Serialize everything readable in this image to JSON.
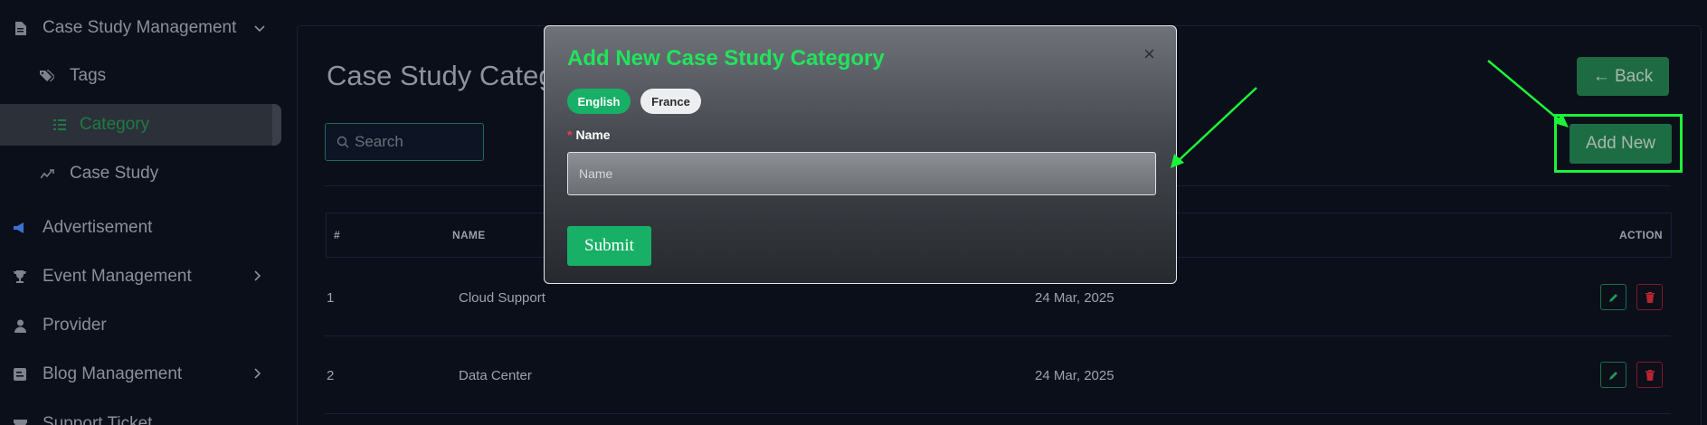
{
  "sidebar": {
    "items": [
      {
        "label": "Case Study Management",
        "icon": "document-icon",
        "has_chevron": true,
        "chevron": "expanded"
      },
      {
        "label": "Tags",
        "icon": "tags-icon"
      },
      {
        "label": "Category",
        "icon": "category-icon",
        "active": true
      },
      {
        "label": "Case Study",
        "icon": "trend-icon"
      },
      {
        "label": "Advertisement",
        "icon": "megaphone-icon"
      },
      {
        "label": "Event Management",
        "icon": "trophy-icon",
        "has_chevron": true
      },
      {
        "label": "Provider",
        "icon": "user-tie-icon"
      },
      {
        "label": "Blog Management",
        "icon": "blog-icon",
        "has_chevron": true
      },
      {
        "label": "Support Ticket",
        "icon": "ticket-icon"
      }
    ]
  },
  "main": {
    "title": "Case Study Categ",
    "back_label": "← Back",
    "add_new_label": "Add New",
    "search_placeholder": "Search",
    "table": {
      "headers": [
        "#",
        "NAME",
        "ACTION"
      ],
      "rows": [
        {
          "index": "1",
          "name": "Cloud Support",
          "date": "24 Mar, 2025"
        },
        {
          "index": "2",
          "name": "Data Center",
          "date": "24 Mar, 2025"
        }
      ]
    }
  },
  "modal": {
    "title": "Add New Case Study Category",
    "close": "×",
    "languages": [
      "English",
      "France"
    ],
    "selected_language": "English",
    "field_label": "Name",
    "required_mark": "*",
    "name_placeholder": "Name",
    "name_value": "",
    "submit_label": "Submit"
  },
  "colors": {
    "accent": "#18b066",
    "title_green": "#21e45c",
    "annotation": "#1cf43a",
    "background": "#0b0f1a"
  }
}
